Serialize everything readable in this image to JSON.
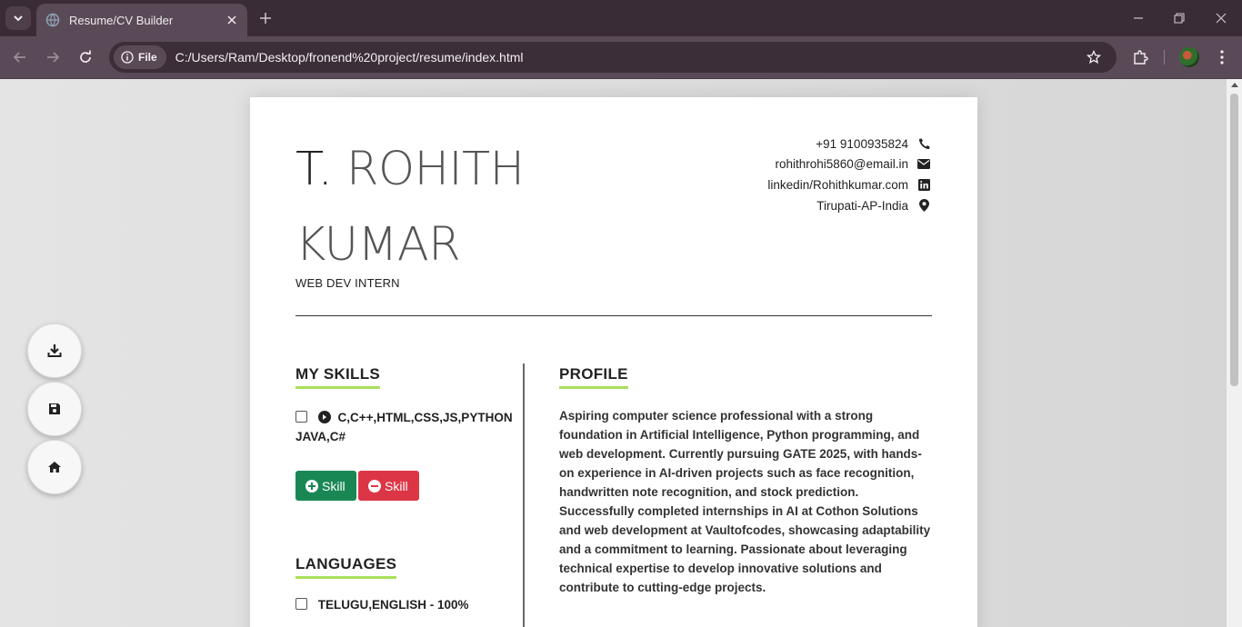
{
  "browser": {
    "tab_title": "Resume/CV Builder",
    "chip_label": "File",
    "url": "C:/Users/Ram/Desktop/fronend%20project/resume/index.html"
  },
  "resume": {
    "name_first": "T.",
    "name_rest": "ROHITH KUMAR",
    "job_title": "WEB DEV INTERN",
    "contact": {
      "phone": "+91 9100935824",
      "email": "rohithrohi5860@email.in",
      "linkedin": "linkedin/Rohithkumar.com",
      "location": "Tirupati-AP-India"
    },
    "skills": {
      "title": "MY SKILLS",
      "items": [
        "C,C++,HTML,CSS,JS,PYTHON JAVA,C#"
      ],
      "add_label": "Skill",
      "remove_label": "Skill"
    },
    "languages": {
      "title": "LANGUAGES",
      "items": [
        {
          "name": "TELUGU,ENGLISH",
          "sep": " - ",
          "level": "100%"
        }
      ]
    },
    "profile": {
      "title": "PROFILE",
      "text": "Aspiring computer science professional with a strong foundation in Artificial Intelligence, Python programming, and web development. Currently pursuing GATE 2025, with hands-on experience in AI-driven projects such as face recognition, handwritten note recognition, and stock prediction. Successfully completed internships in AI at Cothon Solutions and web development at Vaultofcodes, showcasing adaptability and a commitment to learning. Passionate about leveraging technical expertise to develop innovative solutions and contribute to cutting-edge projects."
    }
  },
  "floating_actions": [
    "download-icon",
    "save-icon",
    "home-icon"
  ],
  "colors": {
    "accent_underline": "#a8e05a",
    "add_button": "#198754",
    "remove_button": "#dc3545",
    "chrome_dark": "#3a2c37",
    "chrome_toolbar": "#5a4a57"
  }
}
